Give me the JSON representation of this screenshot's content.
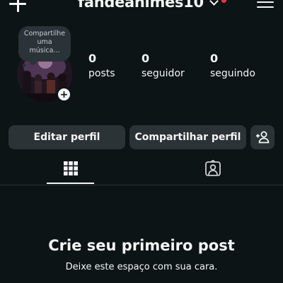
{
  "header": {
    "username": "fandeanimes10",
    "has_notification": true
  },
  "profile": {
    "note_text": "Compartilhe uma música...",
    "stats": [
      {
        "count": "0",
        "label": "posts"
      },
      {
        "count": "0",
        "label": "seguidor"
      },
      {
        "count": "0",
        "label": "seguindo"
      }
    ]
  },
  "actions": {
    "edit_label": "Editar perfil",
    "share_label": "Compartilhar perfil"
  },
  "tabs": [
    {
      "icon": "grid-icon",
      "active": true
    },
    {
      "icon": "tagged-person-icon",
      "active": false
    }
  ],
  "empty_state": {
    "title": "Crie seu primeiro post",
    "subtitle": "Deixe este espaço com sua cara."
  },
  "colors": {
    "background": "#0c1416",
    "button": "#2b3336",
    "notification": "#ff3040",
    "text": "#f5f5f5"
  }
}
